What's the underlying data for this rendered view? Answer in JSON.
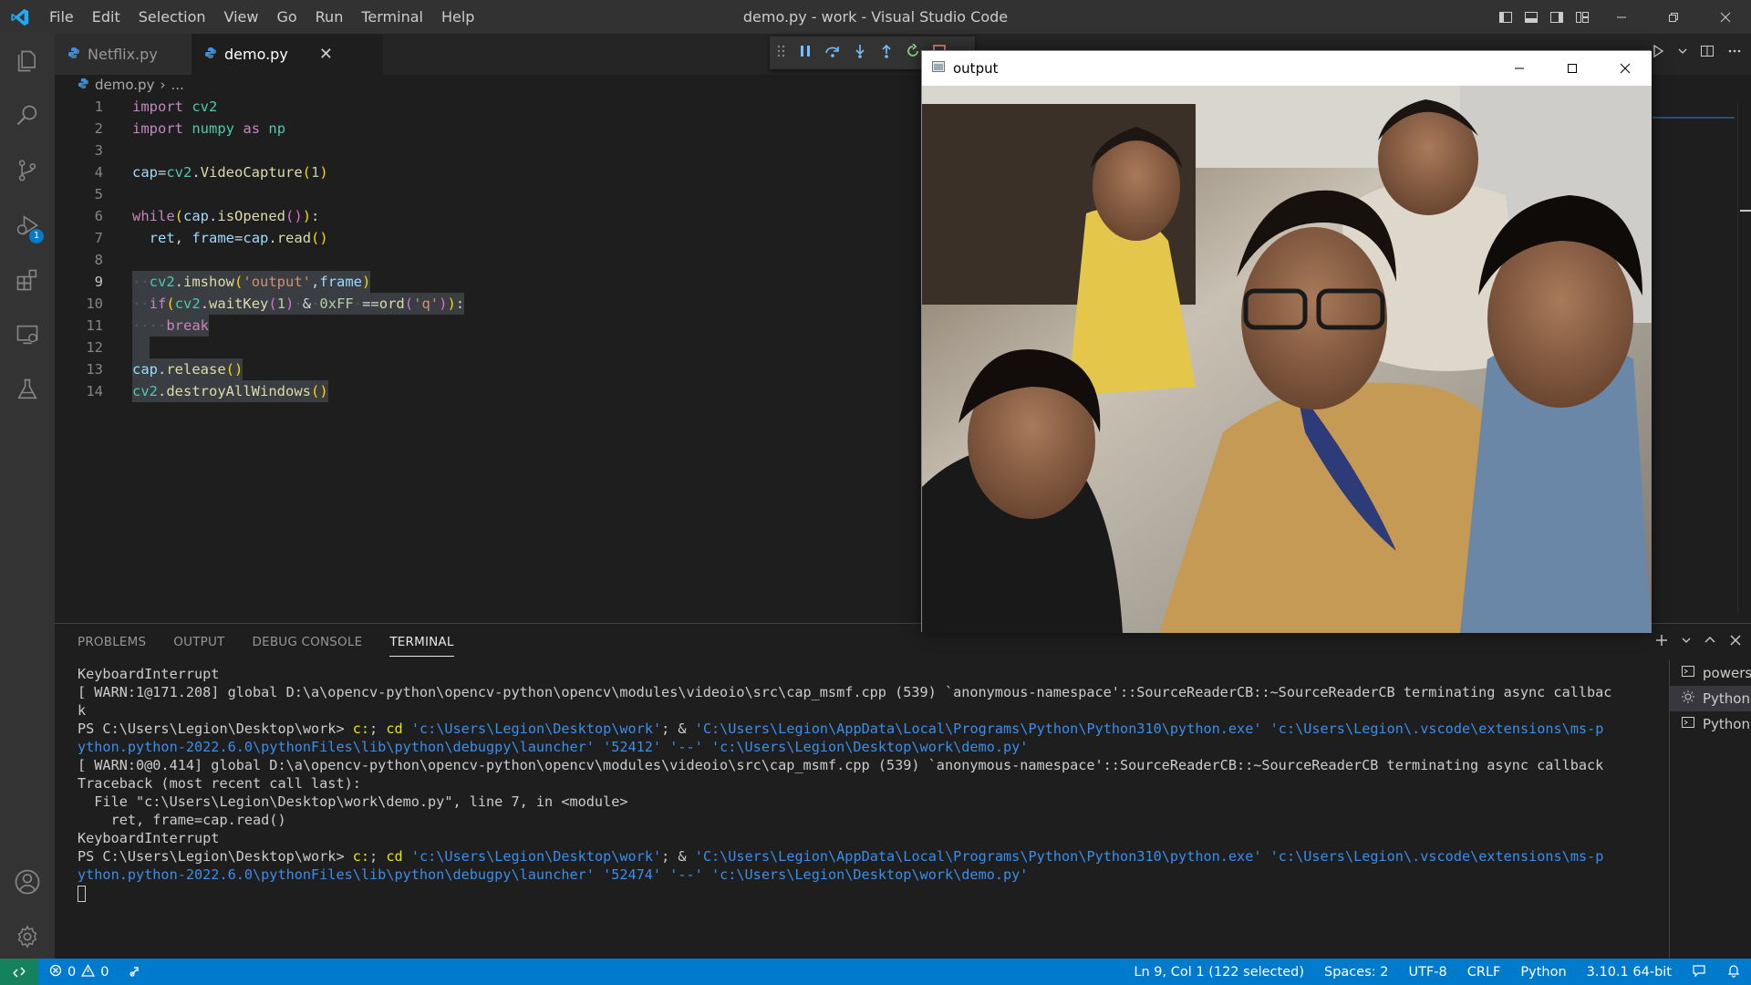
{
  "window": {
    "title": "demo.py - work - Visual Studio Code"
  },
  "menu": [
    "File",
    "Edit",
    "Selection",
    "View",
    "Go",
    "Run",
    "Terminal",
    "Help"
  ],
  "activity_bar": {
    "debug_badge": "1"
  },
  "tabs": [
    {
      "label": "Netflix.py",
      "active": false
    },
    {
      "label": "demo.py",
      "active": true
    }
  ],
  "breadcrumb": {
    "file": "demo.py",
    "rest": "..."
  },
  "code_lines": [
    "1",
    "2",
    "3",
    "4",
    "5",
    "6",
    "7",
    "8",
    "9",
    "10",
    "11",
    "12",
    "13",
    "14"
  ],
  "code_tokens": {
    "import": "import",
    "cv2": "cv2",
    "numpy": "numpy",
    "as": "as",
    "np": "np",
    "cap": "cap",
    "VideoCapture": "VideoCapture",
    "one": "1",
    "while": "while",
    "isOpened": "isOpened",
    "ret": "ret",
    "frame": "frame",
    "read": "read",
    "imshow": "imshow",
    "output_str": "'output'",
    "if": "if",
    "waitKey": "waitKey",
    "hex": "0xFF",
    "ord": "ord",
    "q_str": "'q'",
    "break": "break",
    "release": "release",
    "destroyAllWindows": "destroyAllWindows"
  },
  "panel": {
    "tabs": [
      "PROBLEMS",
      "OUTPUT",
      "DEBUG CONSOLE",
      "TERMINAL"
    ],
    "active_tab": "TERMINAL",
    "terminal_instances": [
      "powershell",
      "Python Deb...",
      "Python"
    ]
  },
  "terminal": {
    "l1": "KeyboardInterrupt",
    "l2": "[ WARN:1@171.208] global D:\\a\\opencv-python\\opencv-python\\opencv\\modules\\videoio\\src\\cap_msmf.cpp (539) `anonymous-namespace'::SourceReaderCB::~SourceReaderCB terminating async callbac",
    "l3": "k",
    "prompt": "PS C:\\Users\\Legion\\Desktop\\work> ",
    "cmd_c": "c:",
    "semi": ";",
    "cd": "cd",
    "path_work": "'c:\\Users\\Legion\\Desktop\\work'",
    "amp": "; &",
    "python_exe": "'C:\\Users\\Legion\\AppData\\Local\\Programs\\Python\\Python310\\python.exe'",
    "ext_a": "'c:\\Users\\Legion\\.vscode\\extensions\\ms-p",
    "ext_b": "ython.python-2022.6.0\\pythonFiles\\lib\\python\\debugpy\\launcher'",
    "port1": "'52412'",
    "port2": "'52474'",
    "dashes": "'--'",
    "demo_path": "'c:\\Users\\Legion\\Desktop\\work\\demo.py'",
    "l6": "[ WARN:0@0.414] global D:\\a\\opencv-python\\opencv-python\\opencv\\modules\\videoio\\src\\cap_msmf.cpp (539) `anonymous-namespace'::SourceReaderCB::~SourceReaderCB terminating async callback",
    "l7": "Traceback (most recent call last):",
    "l8": "  File \"c:\\Users\\Legion\\Desktop\\work\\demo.py\", line 7, in <module>",
    "l9": "    ret, frame=cap.read()",
    "l10": "KeyboardInterrupt"
  },
  "opencv_window": {
    "title": "output"
  },
  "status_bar": {
    "errors": "0",
    "warnings": "0",
    "position": "Ln 9, Col 1 (122 selected)",
    "spaces": "Spaces: 2",
    "encoding": "UTF-8",
    "eol": "CRLF",
    "language": "Python",
    "interpreter": "3.10.1 64-bit"
  },
  "colors": {
    "accent": "#007acc",
    "remote": "#16825d",
    "selection": "#264f78"
  }
}
